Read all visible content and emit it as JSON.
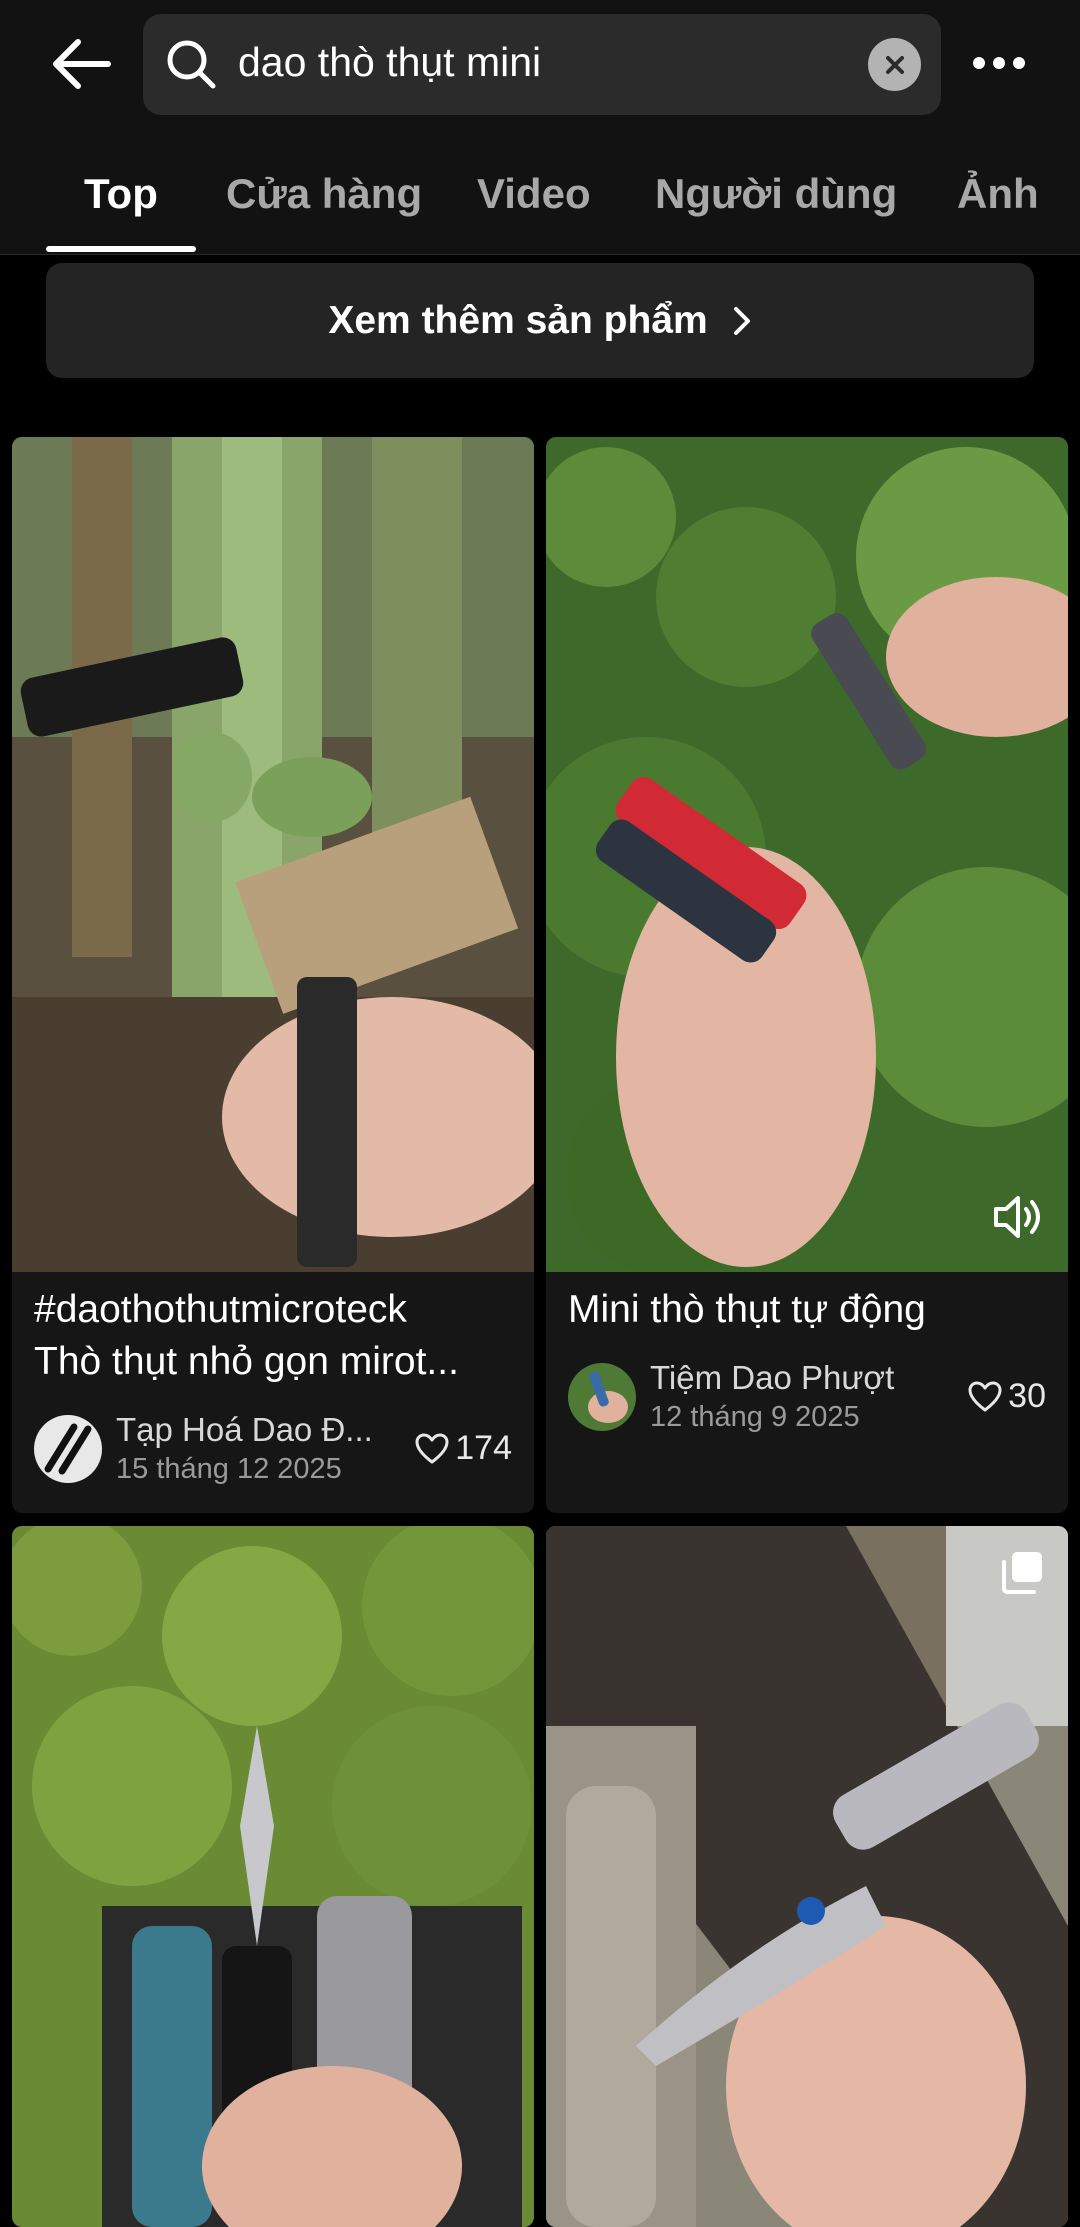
{
  "search": {
    "query": "dao thò thụt mini"
  },
  "tabs": [
    {
      "label": "Top",
      "active": true
    },
    {
      "label": "Cửa hàng",
      "active": false
    },
    {
      "label": "Video",
      "active": false
    },
    {
      "label": "Người dùng",
      "active": false
    },
    {
      "label": "Ảnh",
      "active": false
    }
  ],
  "more_products": {
    "label": "Xem thêm sản phẩm"
  },
  "posts": [
    {
      "caption_line1": "#daothothutmicroteck",
      "caption_line2": "Thò thụt nhỏ gọn mirot...",
      "author": "Tạp Hoá Dao Đ...",
      "date": "15 tháng 12 2025",
      "likes": "174",
      "has_sound_icon": false
    },
    {
      "caption_line1": "Mini thò thụt tự động",
      "caption_line2": "",
      "author": "Tiệm Dao Phượt",
      "date": "12 tháng 9 2025",
      "likes": "30",
      "has_sound_icon": true
    },
    {
      "caption_line1": "",
      "caption_line2": "",
      "author": "",
      "date": "",
      "likes": "",
      "has_sound_icon": false
    },
    {
      "caption_line1": "",
      "caption_line2": "",
      "author": "",
      "date": "",
      "likes": "",
      "has_multi_photo_icon": true
    }
  ],
  "colors": {
    "background": "#000000",
    "header": "#121212",
    "card": "#161616",
    "search_box": "#2b2b2b",
    "active_tab": "#ffffff",
    "inactive_tab": "#a8a8a8"
  },
  "icons": {
    "back": "arrow-left",
    "search": "magnifier",
    "clear": "x-circle",
    "more": "three-dots",
    "chevron": "chevron-right",
    "like": "heart-outline",
    "sound": "speaker",
    "multi_photo": "stacked-squares"
  }
}
